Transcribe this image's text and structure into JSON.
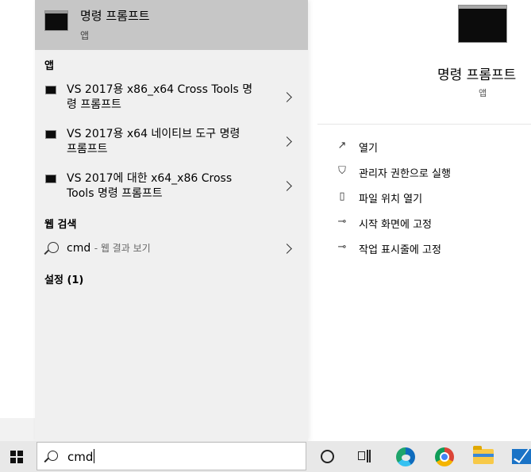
{
  "best_match": {
    "title": "명령 프롬프트",
    "subtitle": "앱"
  },
  "sections": {
    "apps": "앱",
    "web": "웹 검색",
    "settings": "설정 (1)"
  },
  "apps": [
    {
      "line1": "VS 2017용 x86_x64 Cross Tools 명",
      "line2": "령 프롬프트"
    },
    {
      "line1": "VS 2017용 x64 네이티브 도구 명령",
      "line2": "프롬프트"
    },
    {
      "line1": "VS 2017에 대한 x64_x86 Cross",
      "line2": "Tools 명령 프롬프트"
    }
  ],
  "web_search": {
    "query": "cmd",
    "hint": "- 웹 결과 보기"
  },
  "detail": {
    "title": "명령 프롬프트",
    "subtitle": "앱",
    "actions": [
      {
        "label": "열기",
        "icon": "open-icon"
      },
      {
        "label": "관리자 권한으로 실행",
        "icon": "shield-icon"
      },
      {
        "label": "파일 위치 열기",
        "icon": "file-location-icon"
      },
      {
        "label": "시작 화면에 고정",
        "icon": "pin-icon"
      },
      {
        "label": "작업 표시줄에 고정",
        "icon": "pin-icon"
      }
    ]
  },
  "taskbar": {
    "search_value": "cmd",
    "apps": [
      "edge-icon",
      "chrome-icon",
      "file-explorer-icon",
      "mail-icon"
    ]
  },
  "colors": {
    "best_match_bg": "#c6c6c6",
    "results_bg": "#f0f0f0",
    "taskbar_bg": "#e8e8e8"
  }
}
